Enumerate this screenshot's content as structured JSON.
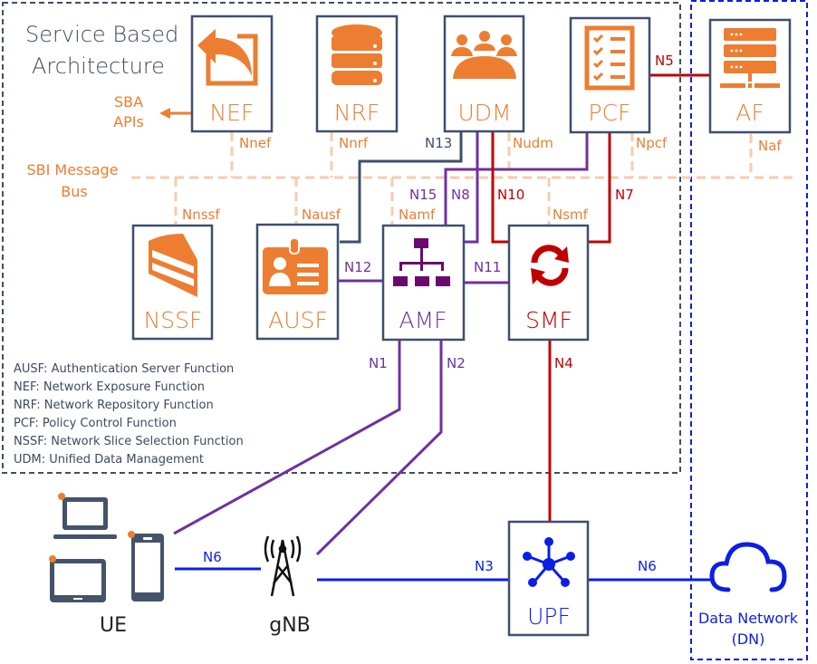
{
  "title": {
    "line1": "Service Based",
    "line2": "Architecture"
  },
  "sba_apis": {
    "line1": "SBA",
    "line2": "APIs"
  },
  "sbi_bus": {
    "line1": "SBI Message",
    "line2": "Bus"
  },
  "colors": {
    "box_border": "#3e4f6e",
    "orange": "#ed7d31",
    "bus": "#f8cbad",
    "purple": "#7030a0",
    "amf_icon": "#6a0a6e",
    "red": "#c00000",
    "blue": "#0a1ee6",
    "dark_text": "#3d4a5e"
  },
  "functions": {
    "nef": {
      "label": "NEF",
      "icon": "undo-arrow-icon",
      "interface": "Nnef"
    },
    "nrf": {
      "label": "NRF",
      "icon": "database-icon",
      "interface": "Nnrf"
    },
    "udm": {
      "label": "UDM",
      "icon": "users-group-icon",
      "interface": "Nudm"
    },
    "pcf": {
      "label": "PCF",
      "icon": "checklist-icon",
      "interface": "Npcf"
    },
    "af": {
      "label": "AF",
      "icon": "server-rack-icon",
      "interface": "Naf"
    },
    "nssf": {
      "label": "NSSF",
      "icon": "cake-slice-icon",
      "interface": "Nnssf"
    },
    "ausf": {
      "label": "AUSF",
      "icon": "id-badge-icon",
      "interface": "Nausf"
    },
    "amf": {
      "label": "AMF",
      "icon": "org-chart-icon",
      "interface": "Namf"
    },
    "smf": {
      "label": "SMF",
      "icon": "refresh-arrows-icon",
      "interface": "Nsmf"
    },
    "upf": {
      "label": "UPF",
      "icon": "hub-network-icon"
    }
  },
  "reference_points": {
    "n1": "N1",
    "n2": "N2",
    "n3": "N3",
    "n4": "N4",
    "n5": "N5",
    "n6_ue": "N6",
    "n6_dn": "N6",
    "n7": "N7",
    "n8": "N8",
    "n10": "N10",
    "n11": "N11",
    "n12": "N12",
    "n13": "N13",
    "n15": "N15"
  },
  "ue": {
    "label": "UE"
  },
  "gnb": {
    "label": "gNB"
  },
  "dn": {
    "line1": "Data Network",
    "line2": "(DN)"
  },
  "legend": [
    "AUSF: Authentication Server Function",
    "NEF: Network Exposure Function",
    "NRF: Network Repository Function",
    "PCF: Policy Control Function",
    "NSSF: Network Slice Selection Function",
    "UDM: Unified Data Management"
  ]
}
